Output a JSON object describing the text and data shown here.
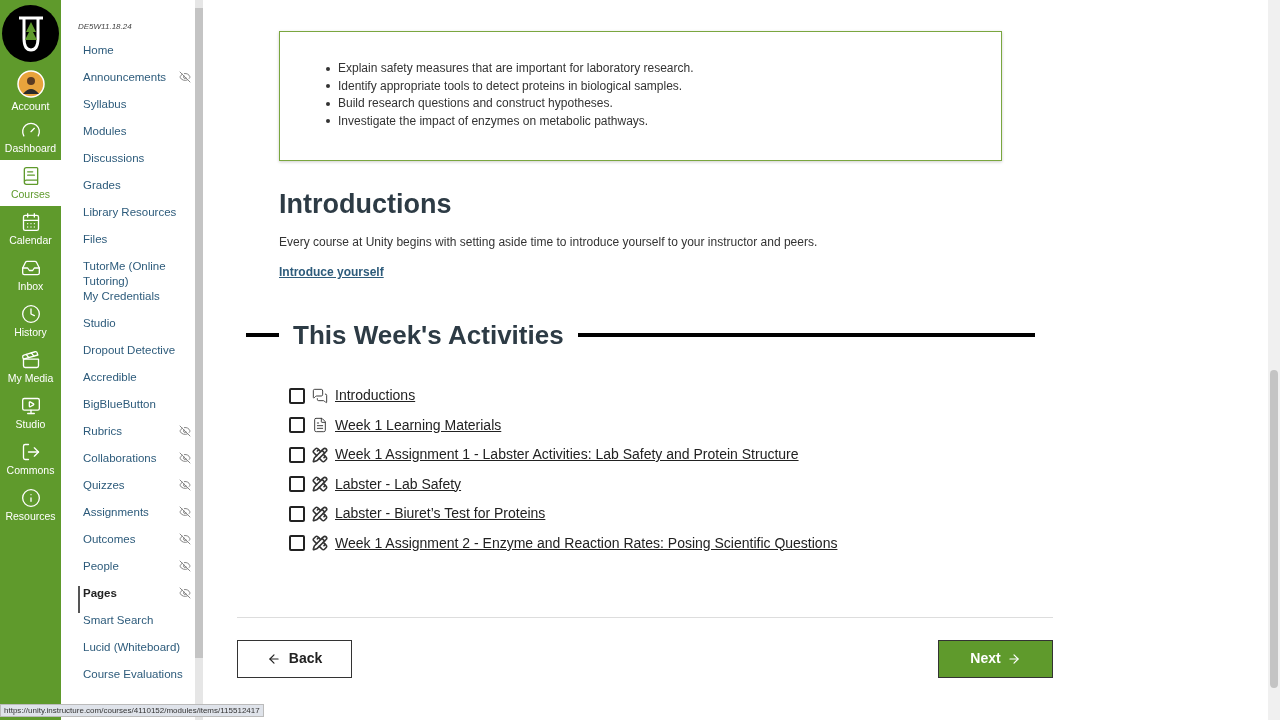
{
  "global_nav": [
    {
      "label": "Account",
      "kind": "account",
      "selected": false
    },
    {
      "label": "Dashboard",
      "kind": "dashboard",
      "selected": false
    },
    {
      "label": "Courses",
      "kind": "courses",
      "selected": true
    },
    {
      "label": "Calendar",
      "kind": "calendar",
      "selected": false
    },
    {
      "label": "Inbox",
      "kind": "inbox",
      "selected": false
    },
    {
      "label": "History",
      "kind": "history",
      "selected": false
    },
    {
      "label": "My Media",
      "kind": "media",
      "selected": false
    },
    {
      "label": "Studio",
      "kind": "studio",
      "selected": false
    },
    {
      "label": "Commons",
      "kind": "commons",
      "selected": false
    },
    {
      "label": "Resources",
      "kind": "resources",
      "selected": false
    }
  ],
  "course_code": "DE5W11.18.24",
  "course_nav": [
    {
      "label": "Home",
      "selected": false,
      "hidden": false
    },
    {
      "label": "Announcements",
      "selected": false,
      "hidden": true
    },
    {
      "label": "Syllabus",
      "selected": false,
      "hidden": false
    },
    {
      "label": "Modules",
      "selected": false,
      "hidden": false
    },
    {
      "label": "Discussions",
      "selected": false,
      "hidden": false
    },
    {
      "label": "Grades",
      "selected": false,
      "hidden": false
    },
    {
      "label": "Library Resources",
      "selected": false,
      "hidden": false
    },
    {
      "label": "Files",
      "selected": false,
      "hidden": false
    },
    {
      "label": "TutorMe (Online Tutoring)",
      "selected": false,
      "hidden": false
    },
    {
      "label": "My Credentials",
      "selected": false,
      "hidden": false
    },
    {
      "label": "Studio",
      "selected": false,
      "hidden": false
    },
    {
      "label": "Dropout Detective",
      "selected": false,
      "hidden": false
    },
    {
      "label": "Accredible",
      "selected": false,
      "hidden": false
    },
    {
      "label": "BigBlueButton",
      "selected": false,
      "hidden": false
    },
    {
      "label": "Rubrics",
      "selected": false,
      "hidden": true
    },
    {
      "label": "Collaborations",
      "selected": false,
      "hidden": true
    },
    {
      "label": "Quizzes",
      "selected": false,
      "hidden": true
    },
    {
      "label": "Assignments",
      "selected": false,
      "hidden": true
    },
    {
      "label": "Outcomes",
      "selected": false,
      "hidden": true
    },
    {
      "label": "People",
      "selected": false,
      "hidden": true
    },
    {
      "label": "Pages",
      "selected": true,
      "hidden": true
    },
    {
      "label": "Smart Search",
      "selected": false,
      "hidden": false
    },
    {
      "label": "Lucid (Whiteboard)",
      "selected": false,
      "hidden": false
    },
    {
      "label": "Course Evaluations",
      "selected": false,
      "hidden": false
    }
  ],
  "objectives": [
    "Explain safety measures that are important for laboratory research.",
    "Identify appropriate tools to detect proteins in biological samples.",
    "Build research questions and construct hypotheses.",
    "Investigate the impact of enzymes on metabolic pathways."
  ],
  "introductions": {
    "heading": "Introductions",
    "text": "Every course at Unity begins with setting aside time to introduce yourself to your instructor and peers.",
    "link": "Introduce yourself"
  },
  "activities_heading": "This Week's Activities",
  "activities": [
    {
      "title": "Introductions",
      "kind": "discussion",
      "checked": false
    },
    {
      "title": "Week 1 Learning Materials",
      "kind": "page",
      "checked": false
    },
    {
      "title": "Week 1 Assignment 1 - Labster Activities: Lab Safety and Protein Structure",
      "kind": "assignment",
      "checked": false
    },
    {
      "title": "Labster - Lab Safety",
      "kind": "assignment",
      "checked": false
    },
    {
      "title": "Labster - Biuret’s Test for Proteins",
      "kind": "assignment",
      "checked": false
    },
    {
      "title": "Week 1 Assignment 2 - Enzyme and Reaction Rates: Posing Scientific Questions",
      "kind": "assignment",
      "checked": false
    }
  ],
  "buttons": {
    "back": "Back",
    "next": "Next"
  },
  "status_url": "https://unity.instructure.com/courses/4110152/modules/items/115512417"
}
